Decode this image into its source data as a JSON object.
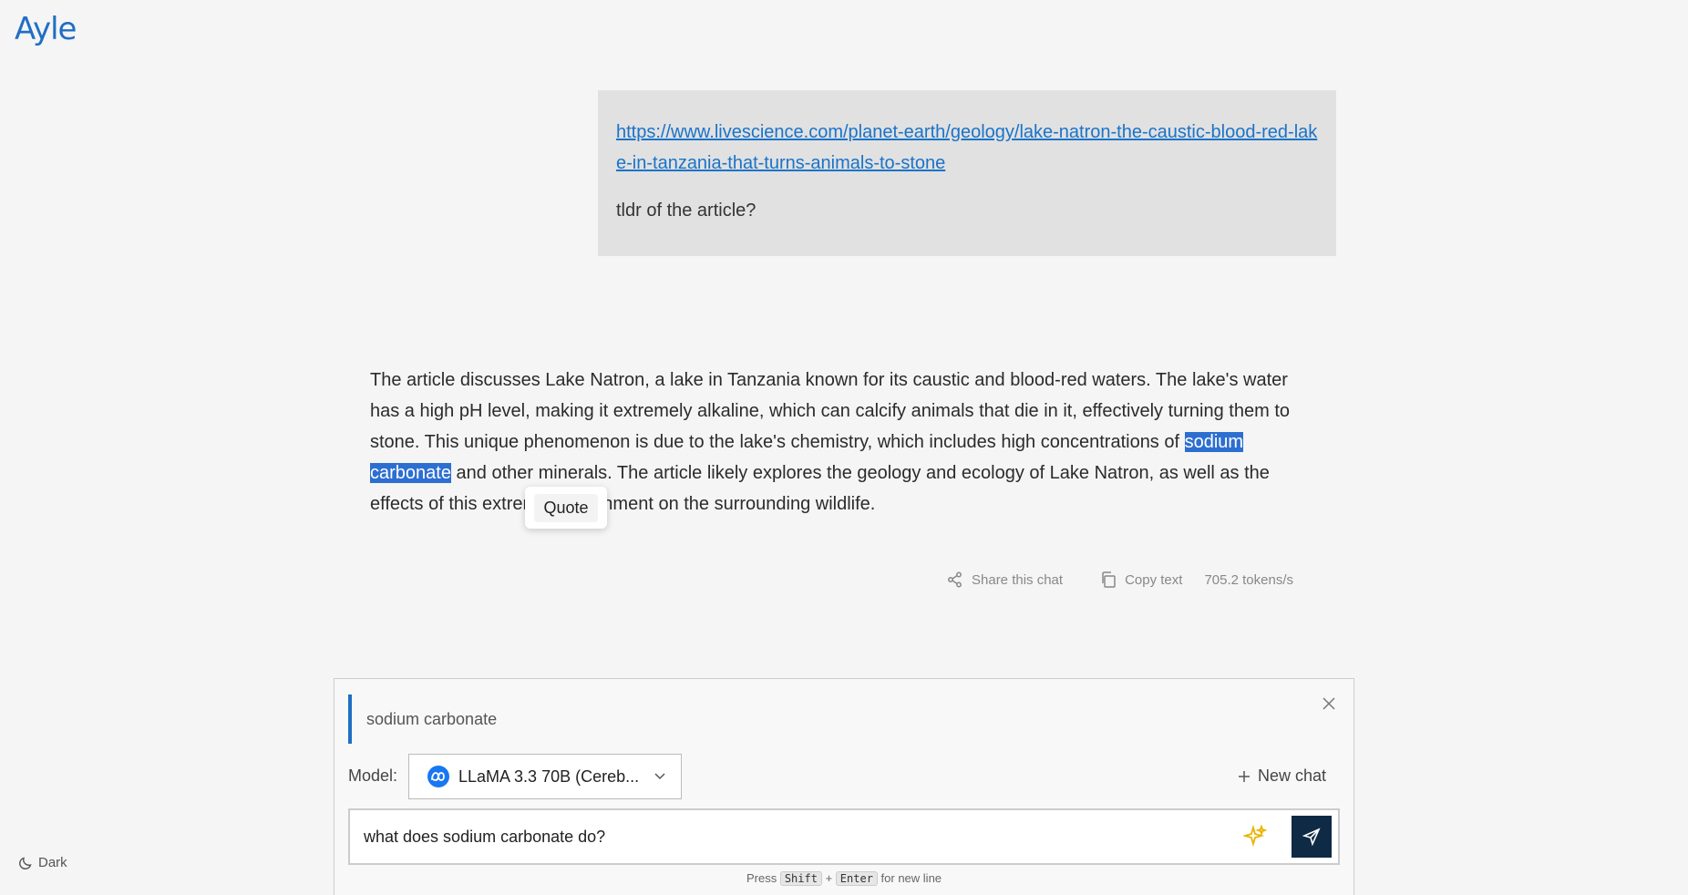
{
  "app": {
    "logo": "Ayle"
  },
  "user_message": {
    "link": "https://www.livescience.com/planet-earth/geology/lake-natron-the-caustic-blood-red-lake-in-tanzania-that-turns-animals-to-stone",
    "text": "tldr of the article?"
  },
  "assistant_message": {
    "before_selection": "The article discusses Lake Natron, a lake in Tanzania known for its caustic and blood-red waters. The lake's water has a high pH level, making it extremely alkaline, which can calcify animals that die in it, effectively turning them to stone. This unique phenomenon is due to the lake's chemistry, which includes high concentrations of ",
    "selected": "sodium carbonate",
    "after_selection": " and other minerals. The article likely explores the geology and ecology of Lake Natron, as well as the effects of this extreme environment on the surrounding wildlife."
  },
  "selection_popup": {
    "label": "Quote"
  },
  "actions": {
    "share": "Share this chat",
    "copy": "Copy text",
    "speed": "705.2 tokens/s"
  },
  "composer": {
    "quote": "sodium carbonate",
    "model_label": "Model:",
    "model_value": "LLaMA 3.3 70B (Cereb...",
    "new_chat": "New chat",
    "input_value": "what does sodium carbonate do?",
    "hint_prefix": "Press",
    "hint_key1": "Shift",
    "hint_plus": "+",
    "hint_key2": "Enter",
    "hint_suffix": "for new line"
  },
  "theme_toggle": {
    "label": "Dark"
  },
  "colors": {
    "accent": "#1f6fc5",
    "selection": "#2d6fd1",
    "send": "#0f2a44",
    "sparkle": "#e8b400"
  }
}
